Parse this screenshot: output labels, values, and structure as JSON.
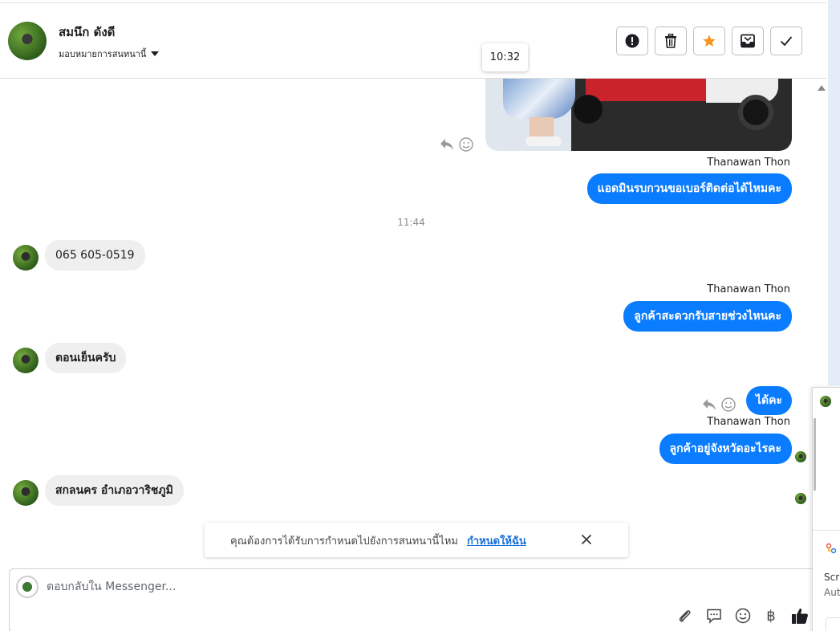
{
  "header": {
    "contact_name": "สมนึก ดังดี",
    "assign_label": "มอบหมายการสนทนานี้",
    "tooltip_time": "10:32",
    "actions": [
      {
        "name": "mark-spam-button",
        "icon": "alert-icon"
      },
      {
        "name": "delete-button",
        "icon": "trash-icon"
      },
      {
        "name": "star-button",
        "icon": "star-icon",
        "color": "#f7931e"
      },
      {
        "name": "move-inbox-button",
        "icon": "inbox-icon"
      },
      {
        "name": "mark-done-button",
        "icon": "check-icon"
      }
    ]
  },
  "messages": {
    "sender_1": "Thanawan Thon",
    "out_1": "แอดมินรบกวนขอเบอร์ติดต่อได้ไหมคะ",
    "time_divider": "11:44",
    "in_1": "065 605-0519",
    "sender_2": "Thanawan Thon",
    "out_2": "ลูกค้าสะดวกรับสายช่วงไหนคะ",
    "in_2": "ตอนเย็นครับ",
    "out_3": "ได้คะ",
    "sender_3": "Thanawan Thon",
    "out_4": "ลูกค้าอยู่จังหวัดอะไรคะ",
    "in_3": "สกลนคร อำเภอวาริชภูมิ"
  },
  "banner": {
    "text": "คุณต้องการได้รับการกำหนดไปยังการสนทนานี้ไหม",
    "link": "กำหนดให้ฉัน"
  },
  "composer": {
    "placeholder": "ตอบกลับใน Messenger...",
    "currency_symbol": "฿"
  },
  "side_panel": {
    "line_1": "Scr",
    "line_2": "Aut"
  },
  "colors": {
    "accent": "#0a7cff",
    "incoming_bubble": "#efefef",
    "star": "#f7931e",
    "link": "#1a6fd8"
  }
}
